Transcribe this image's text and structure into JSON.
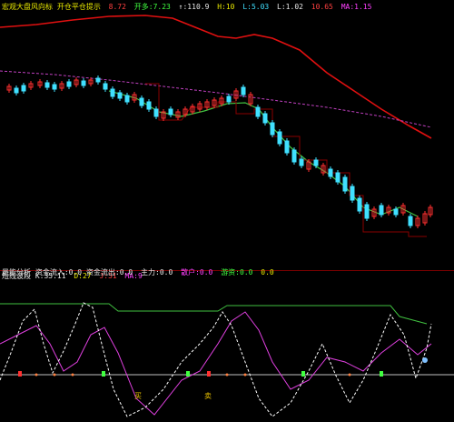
{
  "main_header": {
    "title": "宏观大盘风向标 开仓平仓提示",
    "items": [
      {
        "text": "8.72",
        "color": "red"
      },
      {
        "text": "开多:7.23",
        "color": "green"
      },
      {
        "text": "↑:110.9",
        "color": "white"
      },
      {
        "text": "H:10",
        "color": "yellow"
      },
      {
        "text": "L:5.03",
        "color": "cyan"
      },
      {
        "text": "L:1.02",
        "color": "white"
      },
      {
        "text": "10.65",
        "color": "red"
      },
      {
        "text": "MA:1.15",
        "color": "magenta"
      }
    ]
  },
  "mid_header": {
    "title": "量能分析 资金流入:0.0 资金流出:0.0",
    "items": [
      {
        "text": "主力:0.0",
        "color": "white"
      },
      {
        "text": "散户:0.0",
        "color": "magenta"
      },
      {
        "text": "游资:0.0",
        "color": "green"
      },
      {
        "text": "0.0",
        "color": "yellow"
      }
    ]
  },
  "osc_header": {
    "title": "短线波段 K:35.11",
    "items": [
      {
        "text": "D:27",
        "color": "yellow"
      },
      {
        "text": "J:51",
        "color": "red"
      },
      {
        "text": "MA:9",
        "color": "magenta"
      }
    ]
  },
  "osc_labels": [
    {
      "text": "买"
    },
    {
      "text": "卖"
    }
  ],
  "colors": {
    "up": "#ff3030",
    "down": "#40e0ff",
    "ma_red": "#e01010",
    "ma_green": "#40c040",
    "ma_magenta": "#c040c0",
    "stop_dark": "#8a0000",
    "osc_white": "#ffffff",
    "osc_magenta": "#e040e0",
    "osc_green": "#40c040",
    "baseline": "#c0c0c0"
  }
}
